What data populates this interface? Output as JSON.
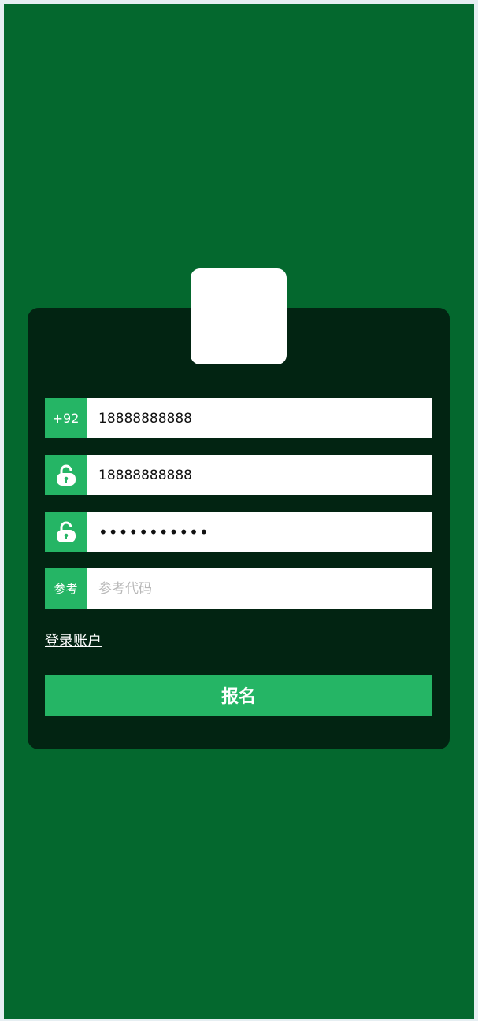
{
  "colors": {
    "background": "#04682e",
    "card": "#022412",
    "accent": "#25b565"
  },
  "form": {
    "phone": {
      "prefix": "+92",
      "value": "18888888888"
    },
    "password": {
      "icon": "lock-icon",
      "value": "18888888888"
    },
    "confirm_password": {
      "icon": "lock-icon",
      "value": "•••••••••••"
    },
    "referral": {
      "prefix": "参考",
      "value": "",
      "placeholder": "参考代码"
    },
    "login_link": "登录账户",
    "submit_label": "报名"
  }
}
